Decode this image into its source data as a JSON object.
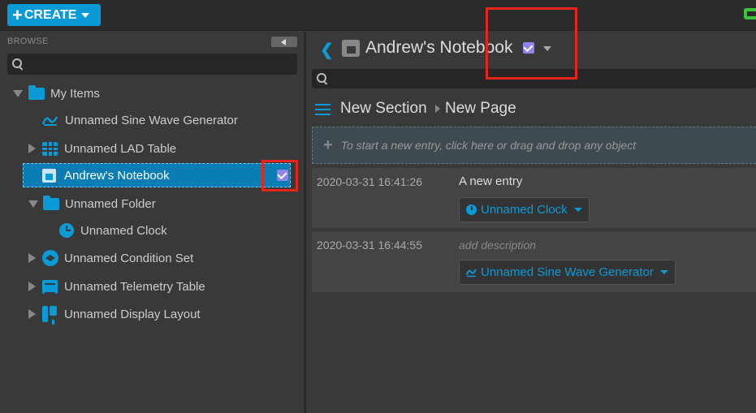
{
  "toolbar": {
    "create_label": "CREATE",
    "create_plus": "+"
  },
  "browse": {
    "label": "BROWSE",
    "search_placeholder": ""
  },
  "tree": {
    "root": {
      "label": "My Items",
      "icon": "folder-icon"
    },
    "items": [
      {
        "label": "Unnamed Sine Wave Generator",
        "icon": "sine-wave-icon"
      },
      {
        "label": "Unnamed LAD Table",
        "icon": "lad-table-icon"
      },
      {
        "label": "Andrew's Notebook",
        "icon": "notebook-icon",
        "selected": true
      },
      {
        "label": "Unnamed Folder",
        "icon": "folder-icon"
      },
      {
        "label": "Unnamed Clock",
        "icon": "clock-icon"
      },
      {
        "label": "Unnamed Condition Set",
        "icon": "condition-set-icon"
      },
      {
        "label": "Unnamed Telemetry Table",
        "icon": "telemetry-table-icon"
      },
      {
        "label": "Unnamed Display Layout",
        "icon": "display-layout-icon"
      }
    ]
  },
  "object": {
    "back": "❮",
    "title": "Andrew's Notebook",
    "search_placeholder": ""
  },
  "notebook_nav": {
    "section": "New Section",
    "page": "New Page"
  },
  "new_entry": {
    "plus": "+",
    "hint": "To start a new entry, click here or drag and drop any object"
  },
  "entries": [
    {
      "timestamp": "2020-03-31 16:41:26",
      "text": "A new entry",
      "embed": "Unnamed Clock"
    },
    {
      "timestamp": "2020-03-31 16:44:55",
      "placeholder": "add description",
      "embed": "Unnamed Sine Wave Generator"
    }
  ],
  "colors": {
    "accent": "#0a9bd6",
    "selection": "#0b7db5",
    "check_badge": "#8f84e8",
    "highlight_box": "#e8251b",
    "top_right_indicator": "#3cc43c"
  }
}
